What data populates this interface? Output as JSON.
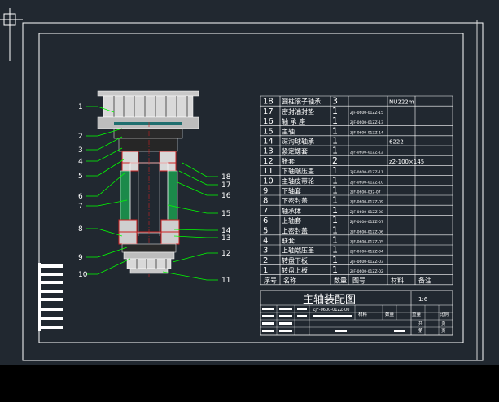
{
  "drawing": {
    "title": "主轴装配图",
    "scale": "1:6",
    "callouts": [
      "1",
      "2",
      "3",
      "4",
      "5",
      "6",
      "7",
      "8",
      "9",
      "10",
      "11",
      "12",
      "13",
      "14",
      "15",
      "16",
      "17",
      "18"
    ],
    "bom": {
      "rows": [
        {
          "no": "18",
          "name": "圆柱滚子轴承",
          "qty": "3",
          "code": "",
          "material": "NU222m",
          "note": ""
        },
        {
          "no": "17",
          "name": "密封油封垫",
          "qty": "1",
          "code": "ZJF-0600-01ZZ-15",
          "material": "",
          "note": ""
        },
        {
          "no": "16",
          "name": "轴 承 座",
          "qty": "1",
          "code": "ZJF-0600-01ZZ-13",
          "material": "",
          "note": ""
        },
        {
          "no": "15",
          "name": "主轴",
          "qty": "1",
          "code": "ZJF-0600-01ZZ-14",
          "material": "",
          "note": ""
        },
        {
          "no": "14",
          "name": "深沟球轴承",
          "qty": "1",
          "code": "",
          "material": "6222",
          "note": ""
        },
        {
          "no": "13",
          "name": "紧定螺套",
          "qty": "1",
          "code": "ZJF-0600-01ZZ-12",
          "material": "",
          "note": ""
        },
        {
          "no": "12",
          "name": "胀套",
          "qty": "2",
          "code": "",
          "material": "z2-100×145",
          "note": ""
        },
        {
          "no": "11",
          "name": "下轴端压盖",
          "qty": "1",
          "code": "ZJF-0600-01ZZ-11",
          "material": "",
          "note": ""
        },
        {
          "no": "10",
          "name": "主轴皮带轮",
          "qty": "1",
          "code": "ZJF-0600-01ZZ-10",
          "material": "",
          "note": ""
        },
        {
          "no": "9",
          "name": "下轴套",
          "qty": "1",
          "code": "ZJF-0600-032-07",
          "material": "",
          "note": ""
        },
        {
          "no": "8",
          "name": "下密封盖",
          "qty": "1",
          "code": "ZJF-0600-01ZZ-09",
          "material": "",
          "note": ""
        },
        {
          "no": "7",
          "name": "轴承体",
          "qty": "1",
          "code": "ZJF-0600-01ZZ-08",
          "material": "",
          "note": ""
        },
        {
          "no": "6",
          "name": "上轴套",
          "qty": "1",
          "code": "ZJF-0600-01ZZ-07",
          "material": "",
          "note": ""
        },
        {
          "no": "5",
          "name": "上密封盖",
          "qty": "1",
          "code": "ZJF-0600-01ZZ-06",
          "material": "",
          "note": ""
        },
        {
          "no": "4",
          "name": "联套",
          "qty": "1",
          "code": "ZJF-0600-01ZZ-05",
          "material": "",
          "note": ""
        },
        {
          "no": "3",
          "name": "上轴端压盖",
          "qty": "1",
          "code": "ZJF-0600-01ZZ-04",
          "material": "",
          "note": ""
        },
        {
          "no": "2",
          "name": "转盘下板",
          "qty": "1",
          "code": "ZJF-0600-01ZZ-03",
          "material": "",
          "note": ""
        },
        {
          "no": "1",
          "name": "转盘上板",
          "qty": "1",
          "code": "ZJF-0600-01ZZ-02",
          "material": "",
          "note": ""
        }
      ],
      "header": {
        "no": "序号",
        "name": "名称",
        "qty": "数量",
        "code": "图号",
        "material": "材料",
        "note": "备注"
      }
    },
    "titleblock": {
      "code": "ZJF-0600-01ZZ-00",
      "col_labels": [
        "材料",
        "数量",
        "重量",
        "比例"
      ],
      "pages": [
        "共",
        "页",
        "第",
        "页"
      ]
    }
  }
}
